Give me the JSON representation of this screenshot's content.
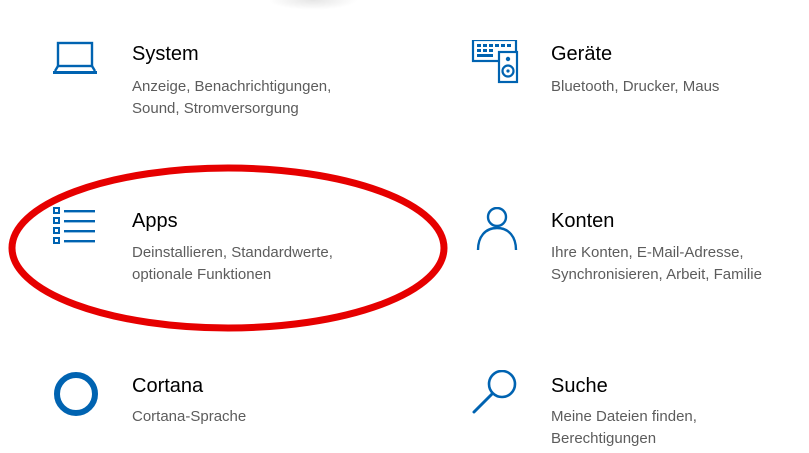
{
  "tiles": {
    "system": {
      "title": "System",
      "description": "Anzeige, Benachrichtigungen,\nSound, Stromversorgung",
      "icon": "laptop-icon"
    },
    "devices": {
      "title": "Geräte",
      "description": "Bluetooth, Drucker, Maus",
      "icon": "devices-icon"
    },
    "apps": {
      "title": "Apps",
      "description": "Deinstallieren, Standardwerte,\noptionale Funktionen",
      "icon": "apps-list-icon"
    },
    "accounts": {
      "title": "Konten",
      "description": "Ihre Konten, E-Mail-Adresse,\nSynchronisieren, Arbeit, Familie",
      "icon": "person-icon"
    },
    "cortana": {
      "title": "Cortana",
      "description": "Cortana-Sprache",
      "icon": "cortana-ring-icon"
    },
    "search": {
      "title": "Suche",
      "description": "Meine Dateien finden,\nBerechtigungen",
      "icon": "search-icon"
    }
  },
  "colors": {
    "accent": "#0063b1",
    "highlight": "#e60000",
    "description_text": "#5c5c5c"
  }
}
